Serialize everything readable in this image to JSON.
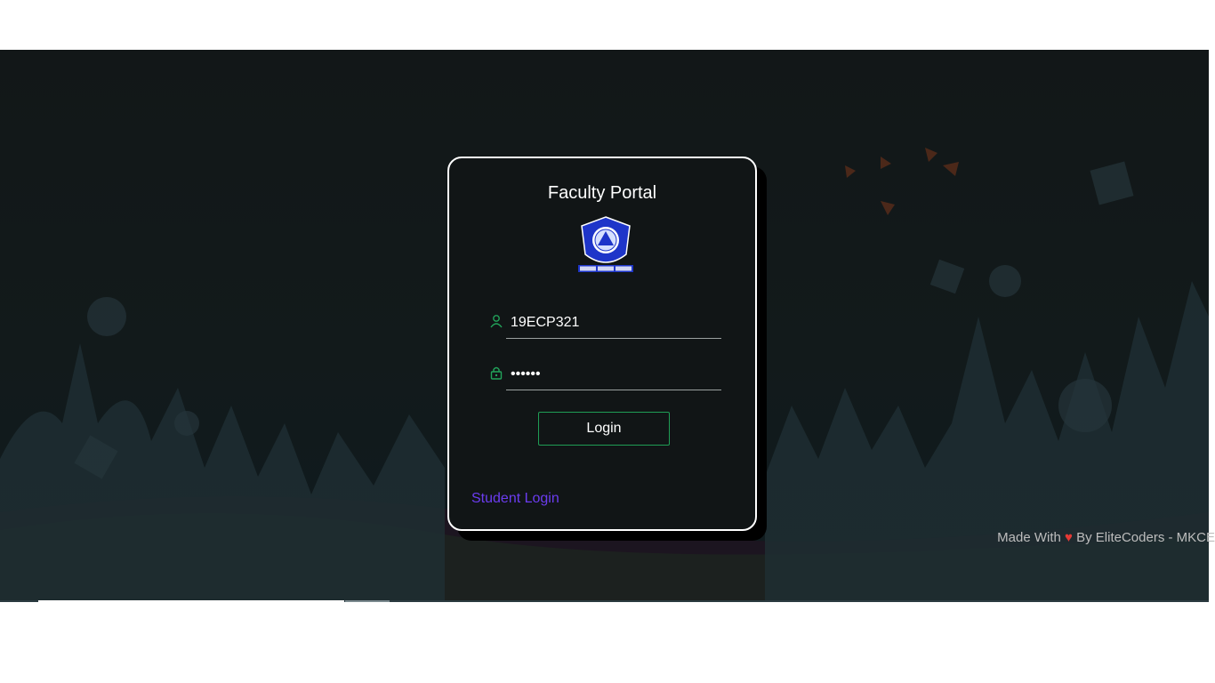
{
  "portal": {
    "title": "Faculty Portal",
    "username_value": "19ECP321",
    "password_value": "123456",
    "login_label": "Login",
    "student_link_label": "Student Login"
  },
  "footer": {
    "made_with": "Made With",
    "heart": "♥",
    "by": "By EliteCoders - MKCE"
  },
  "colors": {
    "accent_green": "#1f9d55",
    "link_purple": "#6b3cf0",
    "heart_red": "#e53935"
  },
  "icons": {
    "user": "user-icon",
    "lock": "lock-icon"
  }
}
